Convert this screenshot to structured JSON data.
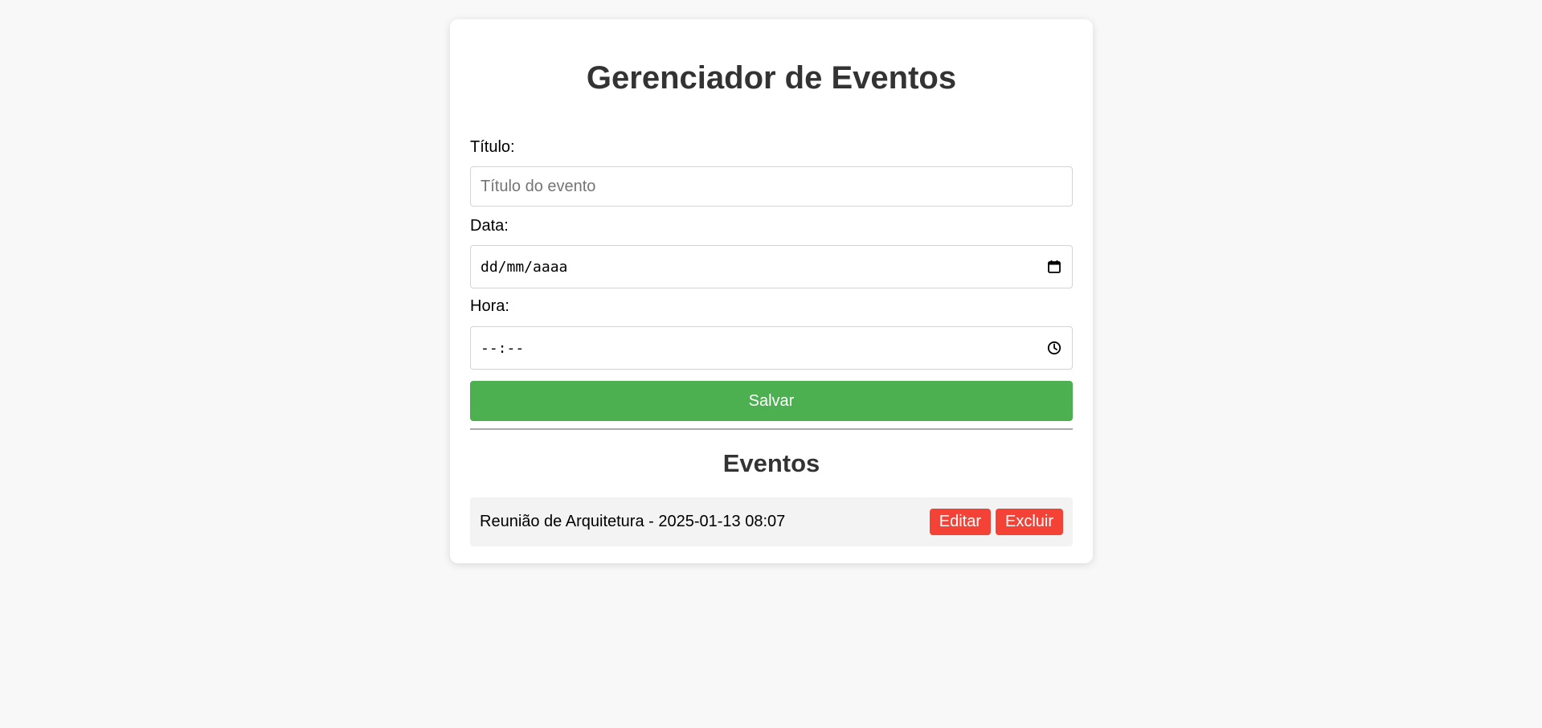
{
  "header": {
    "title": "Gerenciador de Eventos"
  },
  "form": {
    "title_label": "Título:",
    "title_placeholder": "Título do evento",
    "title_value": "",
    "date_label": "Data:",
    "date_value": "dd/mm/aaaa",
    "date_icon": "calendar-icon",
    "time_label": "Hora:",
    "time_value": "--:--",
    "time_icon": "clock-icon",
    "save_label": "Salvar"
  },
  "events": {
    "heading": "Eventos",
    "items": [
      {
        "text": "Reunião de Arquitetura - 2025-01-13 08:07",
        "edit_label": "Editar",
        "delete_label": "Excluir"
      }
    ]
  },
  "colors": {
    "background": "#f8f8f8",
    "card": "#ffffff",
    "title": "#333333",
    "save_button": "#4caf50",
    "action_button": "#f44336",
    "event_row": "#f3f3f3"
  }
}
